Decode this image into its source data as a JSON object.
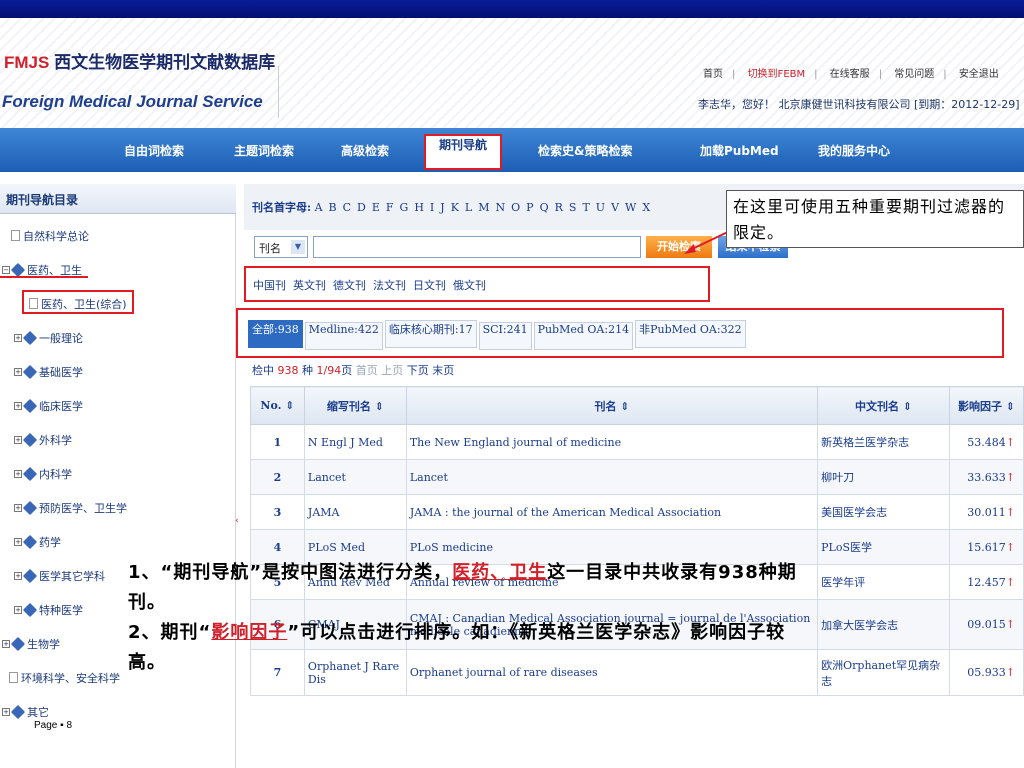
{
  "header": {
    "logo_brand": "FMJS",
    "logo_cn": "西文生物医学期刊文献数据库",
    "logo_en": "Foreign Medical Journal Service",
    "links": [
      "首页",
      "切换到FEBM",
      "在线客服",
      "常见问题",
      "安全退出"
    ],
    "user_line": "李志华，您好！ 北京康健世讯科技有限公司 [到期：2012-12-29]"
  },
  "nav": {
    "items": [
      "自由词检索",
      "主题词检索",
      "高级检索",
      "期刊导航",
      "检索史&策略检索",
      "加载PubMed",
      "我的服务中心"
    ]
  },
  "sidebar": {
    "title": "期刊导航目录",
    "items": [
      "自然科学总论",
      "医药、卫生",
      "医药、卫生(综合)",
      "一般理论",
      "基础医学",
      "临床医学",
      "外科学",
      "内科学",
      "预防医学、卫生学",
      "药学",
      "医学其它学科",
      "特种医学",
      "生物学",
      "环境科学、安全科学",
      "其它"
    ],
    "collapse_glyph": "‹"
  },
  "alpha": {
    "label": "刊名首字母:",
    "letters": [
      "A",
      "B",
      "C",
      "D",
      "E",
      "F",
      "G",
      "H",
      "I",
      "J",
      "K",
      "L",
      "M",
      "N",
      "O",
      "P",
      "Q",
      "R",
      "S",
      "T",
      "U",
      "V",
      "W",
      "X"
    ]
  },
  "search": {
    "select_value": "刊名",
    "button_search": "开始检索",
    "button_result": "结果中检索"
  },
  "callout": "在这里可使用五种重要期刊过滤器的限定。",
  "languages": [
    "中国刊",
    "英文刊",
    "德文刊",
    "法文刊",
    "日文刊",
    "俄文刊"
  ],
  "filters": [
    "全部:938",
    "Medline:422",
    "临床核心期刊:17",
    "SCI:241",
    "PubMed OA:214",
    "非PubMed OA:322"
  ],
  "found": {
    "prefix": "检中",
    "count": "938",
    "unit": "种",
    "page": "1/94",
    "page_unit": "页",
    "first": "首页",
    "prev": "上页",
    "next": "下页",
    "last": "末页"
  },
  "table": {
    "headers": [
      "No.",
      "缩写刊名",
      "刊名",
      "中文刊名",
      "影响因子"
    ],
    "sort_glyph": "⇕",
    "up_glyph": "↑",
    "rows": [
      {
        "no": "1",
        "abbr": "N Engl J Med",
        "title": "The New England journal of medicine",
        "cn": "新英格兰医学杂志",
        "if": "53.484"
      },
      {
        "no": "2",
        "abbr": "Lancet",
        "title": "Lancet",
        "cn": "柳叶刀",
        "if": "33.633"
      },
      {
        "no": "3",
        "abbr": "JAMA",
        "title": "JAMA : the journal of the American Medical Association",
        "cn": "美国医学会志",
        "if": "30.011"
      },
      {
        "no": "4",
        "abbr": "PLoS Med",
        "title": "PLoS medicine",
        "cn": "PLoS医学",
        "if": "15.617"
      },
      {
        "no": "5",
        "abbr": "Annu Rev Med",
        "title": "Annual review of medicine",
        "cn": "医学年评",
        "if": "12.457"
      },
      {
        "no": "6",
        "abbr": "CMAJ",
        "title": "CMAJ : Canadian Medical Association journal = journal de l'Association medicale canadienne",
        "cn": "加拿大医学会志",
        "if": "09.015"
      },
      {
        "no": "7",
        "abbr": "Orphanet J Rare Dis",
        "title": "Orphanet journal of rare diseases",
        "cn": "欧洲Orphanet罕见病杂志",
        "if": "05.933"
      }
    ]
  },
  "overlay": {
    "line1a": "1、“期刊导航”是按中图法进行分类，",
    "line1red": "医药、卫生",
    "line1b": "这一目录中共收录有938种期刊。",
    "line2a": "2、期刊“",
    "line2red": "影响因子",
    "line2b": "”可以点击进行排序。如：《新英格兰医学杂志》影响因子较高。"
  },
  "footer": "Page ▪ 8"
}
